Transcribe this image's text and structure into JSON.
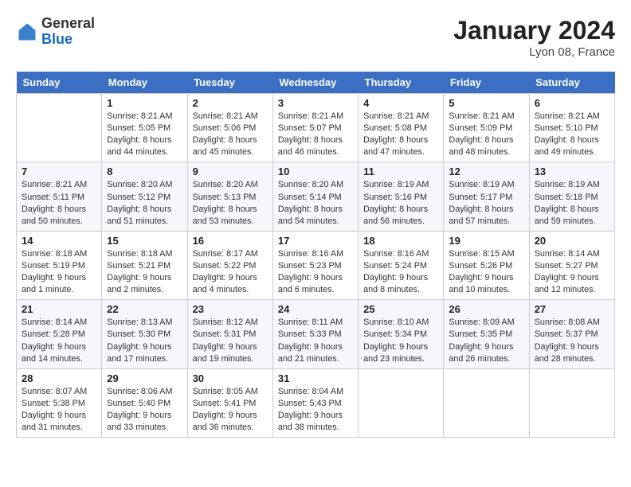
{
  "header": {
    "logo_general": "General",
    "logo_blue": "Blue",
    "month_title": "January 2024",
    "subtitle": "Lyon 08, France"
  },
  "weekdays": [
    "Sunday",
    "Monday",
    "Tuesday",
    "Wednesday",
    "Thursday",
    "Friday",
    "Saturday"
  ],
  "weeks": [
    [
      {
        "day": "",
        "info": ""
      },
      {
        "day": "1",
        "info": "Sunrise: 8:21 AM\nSunset: 5:05 PM\nDaylight: 8 hours\nand 44 minutes."
      },
      {
        "day": "2",
        "info": "Sunrise: 8:21 AM\nSunset: 5:06 PM\nDaylight: 8 hours\nand 45 minutes."
      },
      {
        "day": "3",
        "info": "Sunrise: 8:21 AM\nSunset: 5:07 PM\nDaylight: 8 hours\nand 46 minutes."
      },
      {
        "day": "4",
        "info": "Sunrise: 8:21 AM\nSunset: 5:08 PM\nDaylight: 8 hours\nand 47 minutes."
      },
      {
        "day": "5",
        "info": "Sunrise: 8:21 AM\nSunset: 5:09 PM\nDaylight: 8 hours\nand 48 minutes."
      },
      {
        "day": "6",
        "info": "Sunrise: 8:21 AM\nSunset: 5:10 PM\nDaylight: 8 hours\nand 49 minutes."
      }
    ],
    [
      {
        "day": "7",
        "info": "Sunrise: 8:21 AM\nSunset: 5:11 PM\nDaylight: 8 hours\nand 50 minutes."
      },
      {
        "day": "8",
        "info": "Sunrise: 8:20 AM\nSunset: 5:12 PM\nDaylight: 8 hours\nand 51 minutes."
      },
      {
        "day": "9",
        "info": "Sunrise: 8:20 AM\nSunset: 5:13 PM\nDaylight: 8 hours\nand 53 minutes."
      },
      {
        "day": "10",
        "info": "Sunrise: 8:20 AM\nSunset: 5:14 PM\nDaylight: 8 hours\nand 54 minutes."
      },
      {
        "day": "11",
        "info": "Sunrise: 8:19 AM\nSunset: 5:16 PM\nDaylight: 8 hours\nand 56 minutes."
      },
      {
        "day": "12",
        "info": "Sunrise: 8:19 AM\nSunset: 5:17 PM\nDaylight: 8 hours\nand 57 minutes."
      },
      {
        "day": "13",
        "info": "Sunrise: 8:19 AM\nSunset: 5:18 PM\nDaylight: 8 hours\nand 59 minutes."
      }
    ],
    [
      {
        "day": "14",
        "info": "Sunrise: 8:18 AM\nSunset: 5:19 PM\nDaylight: 9 hours\nand 1 minute."
      },
      {
        "day": "15",
        "info": "Sunrise: 8:18 AM\nSunset: 5:21 PM\nDaylight: 9 hours\nand 2 minutes."
      },
      {
        "day": "16",
        "info": "Sunrise: 8:17 AM\nSunset: 5:22 PM\nDaylight: 9 hours\nand 4 minutes."
      },
      {
        "day": "17",
        "info": "Sunrise: 8:16 AM\nSunset: 5:23 PM\nDaylight: 9 hours\nand 6 minutes."
      },
      {
        "day": "18",
        "info": "Sunrise: 8:16 AM\nSunset: 5:24 PM\nDaylight: 9 hours\nand 8 minutes."
      },
      {
        "day": "19",
        "info": "Sunrise: 8:15 AM\nSunset: 5:26 PM\nDaylight: 9 hours\nand 10 minutes."
      },
      {
        "day": "20",
        "info": "Sunrise: 8:14 AM\nSunset: 5:27 PM\nDaylight: 9 hours\nand 12 minutes."
      }
    ],
    [
      {
        "day": "21",
        "info": "Sunrise: 8:14 AM\nSunset: 5:28 PM\nDaylight: 9 hours\nand 14 minutes."
      },
      {
        "day": "22",
        "info": "Sunrise: 8:13 AM\nSunset: 5:30 PM\nDaylight: 9 hours\nand 17 minutes."
      },
      {
        "day": "23",
        "info": "Sunrise: 8:12 AM\nSunset: 5:31 PM\nDaylight: 9 hours\nand 19 minutes."
      },
      {
        "day": "24",
        "info": "Sunrise: 8:11 AM\nSunset: 5:33 PM\nDaylight: 9 hours\nand 21 minutes."
      },
      {
        "day": "25",
        "info": "Sunrise: 8:10 AM\nSunset: 5:34 PM\nDaylight: 9 hours\nand 23 minutes."
      },
      {
        "day": "26",
        "info": "Sunrise: 8:09 AM\nSunset: 5:35 PM\nDaylight: 9 hours\nand 26 minutes."
      },
      {
        "day": "27",
        "info": "Sunrise: 8:08 AM\nSunset: 5:37 PM\nDaylight: 9 hours\nand 28 minutes."
      }
    ],
    [
      {
        "day": "28",
        "info": "Sunrise: 8:07 AM\nSunset: 5:38 PM\nDaylight: 9 hours\nand 31 minutes."
      },
      {
        "day": "29",
        "info": "Sunrise: 8:06 AM\nSunset: 5:40 PM\nDaylight: 9 hours\nand 33 minutes."
      },
      {
        "day": "30",
        "info": "Sunrise: 8:05 AM\nSunset: 5:41 PM\nDaylight: 9 hours\nand 36 minutes."
      },
      {
        "day": "31",
        "info": "Sunrise: 8:04 AM\nSunset: 5:43 PM\nDaylight: 9 hours\nand 38 minutes."
      },
      {
        "day": "",
        "info": ""
      },
      {
        "day": "",
        "info": ""
      },
      {
        "day": "",
        "info": ""
      }
    ]
  ]
}
